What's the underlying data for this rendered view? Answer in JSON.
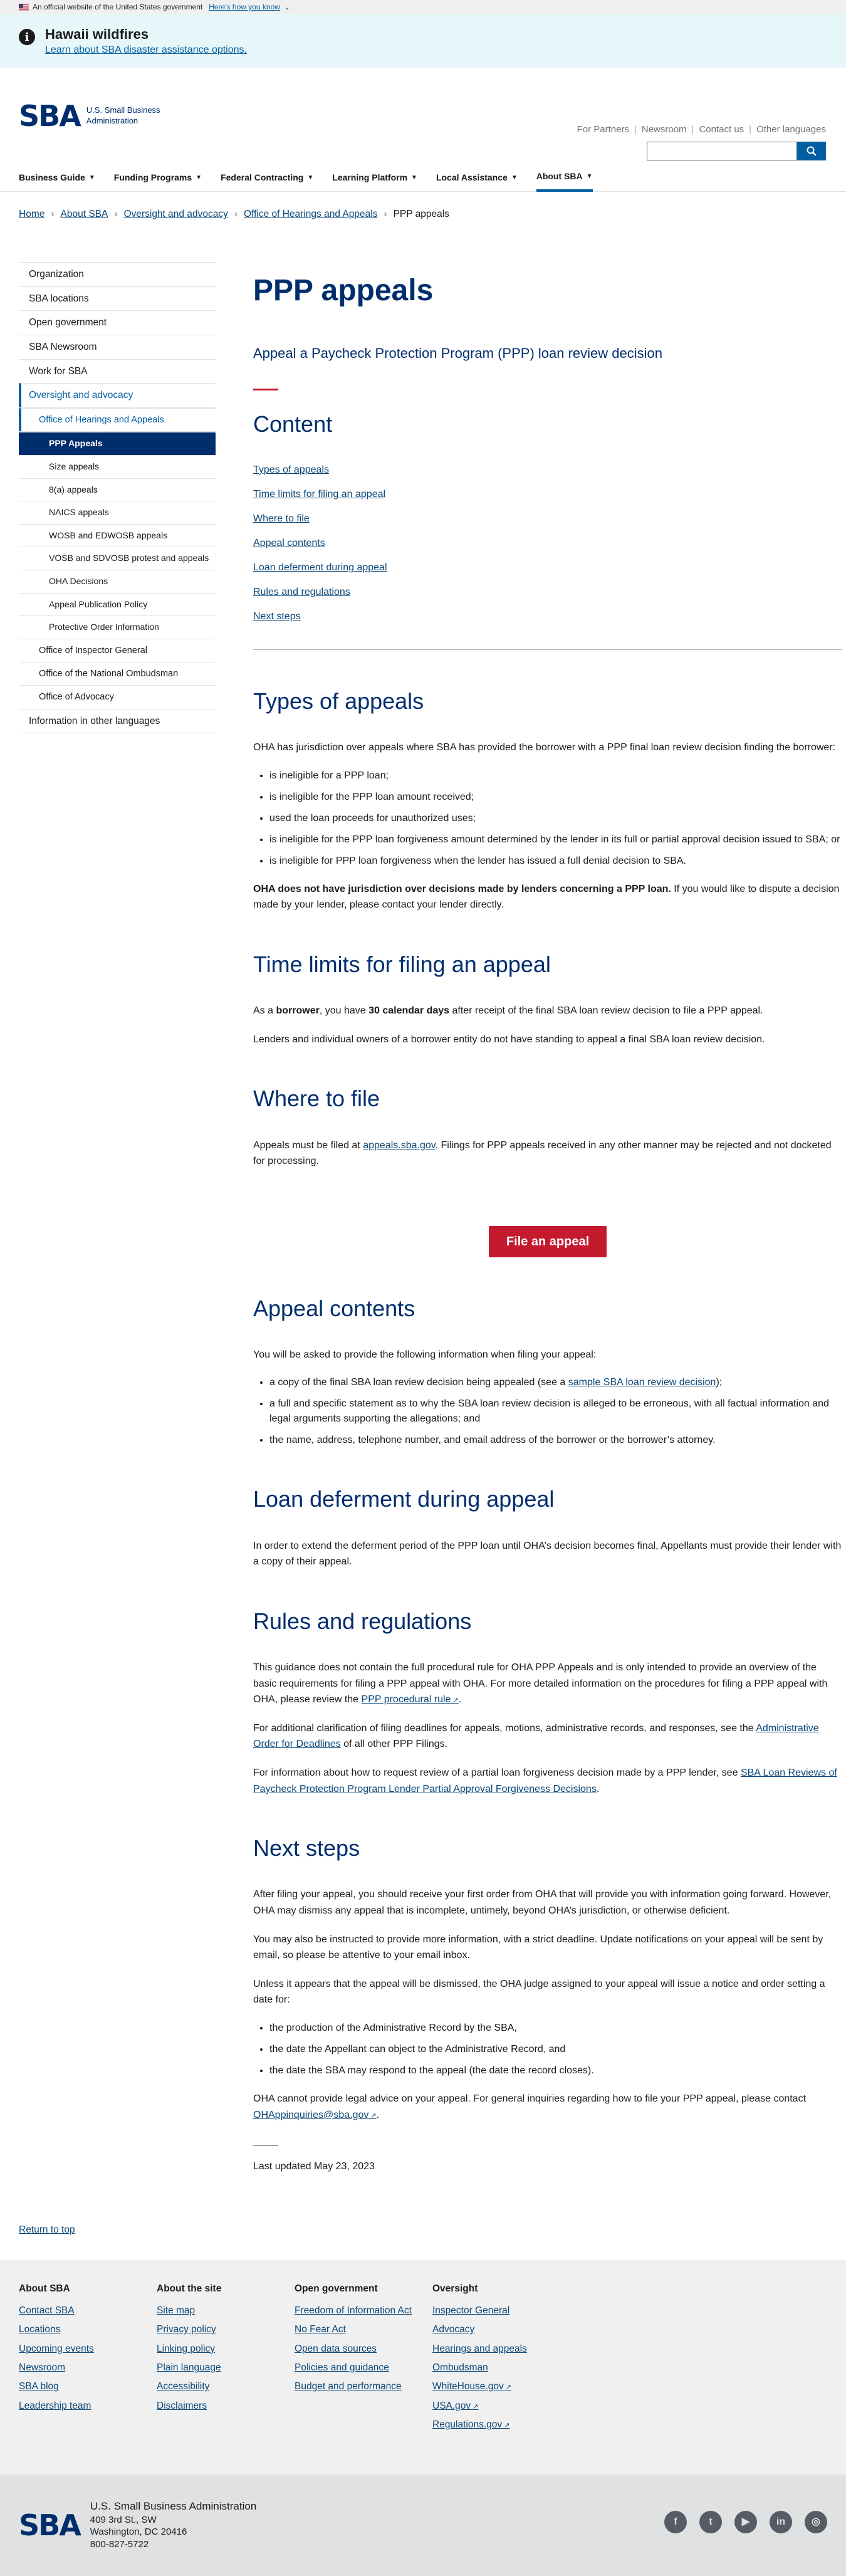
{
  "gov_banner": {
    "text": "An official website of the United States government",
    "link": "Here's how you know",
    "chevron": "⌄"
  },
  "alert": {
    "title": "Hawaii wildfires",
    "link": "Learn about SBA disaster assistance options."
  },
  "header": {
    "logo_mark": "SBA",
    "logo_name_line1": "U.S. Small Business",
    "logo_name_line2": "Administration",
    "top_links": [
      "For Partners",
      "Newsroom",
      "Contact us",
      "Other languages"
    ],
    "search_placeholder": "",
    "search_icon": "search-icon"
  },
  "nav": [
    {
      "label": "Business Guide"
    },
    {
      "label": "Funding Programs"
    },
    {
      "label": "Federal Contracting"
    },
    {
      "label": "Learning Platform"
    },
    {
      "label": "Local Assistance"
    },
    {
      "label": "About SBA"
    }
  ],
  "breadcrumb": {
    "items": [
      "Home",
      "About SBA",
      "Oversight and advocacy",
      "Office of Hearings and Appeals"
    ],
    "current": "PPP appeals"
  },
  "sidenav": {
    "top": [
      "Organization",
      "SBA locations",
      "Open government",
      "SBA Newsroom",
      "Work for SBA"
    ],
    "oversight": "Oversight and advocacy",
    "oha": "Office of Hearings and Appeals",
    "oha_items": [
      "PPP Appeals",
      "Size appeals",
      "8(a) appeals",
      "NAICS appeals",
      "WOSB and EDWOSB appeals",
      "VOSB and SDVOSB protest and appeals",
      "OHA Decisions",
      "Appeal Publication Policy",
      "Protective Order Information"
    ],
    "oversight_items": [
      "Office of Inspector General",
      "Office of the National Ombudsman",
      "Office of Advocacy"
    ],
    "bottom": "Information in other languages"
  },
  "main": {
    "title": "PPP appeals",
    "subtitle": "Appeal a Paycheck Protection Program (PPP) loan review decision",
    "toc_title": "Content",
    "toc": [
      "Types of appeals",
      "Time limits for filing an appeal",
      "Where to file",
      "Appeal contents",
      "Loan deferment during appeal",
      "Rules and regulations",
      "Next steps"
    ],
    "types": {
      "heading": "Types of appeals",
      "intro": "OHA has jurisdiction over appeals where SBA has provided the borrower with a PPP final loan review decision finding the borrower:",
      "items": [
        "is ineligible for a PPP loan;",
        "is ineligible for the PPP loan amount received;",
        "used the loan proceeds for unauthorized uses;",
        "is ineligible for the PPP loan forgiveness amount determined by the lender in its full or partial approval decision issued to SBA; or",
        "is ineligible for PPP loan forgiveness when the lender has issued a full denial decision to SBA."
      ],
      "note_bold": "OHA does not have jurisdiction over decisions made by lenders concerning a PPP loan.",
      "note_rest": " If you would like to dispute a decision made by your lender, please contact your lender directly."
    },
    "time": {
      "heading": "Time limits for filing an appeal",
      "p1_a": "As a ",
      "p1_b": "borrower",
      "p1_c": ", you have ",
      "p1_d": "30 calendar days",
      "p1_e": " after receipt of the final SBA loan review decision to file a PPP appeal.",
      "p2": "Lenders and individual owners of a borrower entity do not have standing to appeal a final SBA loan review decision."
    },
    "where": {
      "heading": "Where to file",
      "p_a": "Appeals must be filed at ",
      "link": "appeals.sba.gov",
      "p_b": ".  Filings for PPP appeals received in any other manner may be rejected and not docketed for processing.",
      "button": "File an appeal"
    },
    "contents": {
      "heading": "Appeal contents",
      "intro": "You will be asked to provide the following information when filing your appeal:",
      "item1_a": "a copy of the final SBA loan review decision being appealed (see a ",
      "item1_link": "sample SBA loan review decision",
      "item1_b": ");",
      "item2": "a full and specific statement as to why the SBA loan review decision is alleged to be erroneous, with all factual information and legal arguments supporting the allegations; and",
      "item3": "the name, address, telephone number, and email address of the borrower or the borrower’s attorney."
    },
    "deferment": {
      "heading": "Loan deferment during appeal",
      "p": "In order to extend the deferment period of the PPP loan until OHA’s decision becomes final, Appellants must provide their lender with a copy of their appeal."
    },
    "rules": {
      "heading": "Rules and regulations",
      "p1_a": "This guidance does not contain the full procedural rule for OHA PPP Appeals and is only intended to provide an overview of the basic requirements for filing a PPP appeal with OHA. For more detailed information on the procedures for filing a PPP appeal with OHA, please review the ",
      "p1_link": "PPP procedural rule",
      "p1_b": ".",
      "p2_a": "For additional clarification of filing deadlines for appeals, motions, administrative records, and responses, see the ",
      "p2_link": "Administrative Order for Deadlines",
      "p2_b": " of all other PPP Filings.",
      "p3_a": "For information about how to request review of a partial loan forgiveness decision made by a PPP lender, see ",
      "p3_link": "SBA Loan Reviews of Paycheck Protection Program Lender Partial Approval Forgiveness Decisions",
      "p3_b": "."
    },
    "next": {
      "heading": "Next steps",
      "p1": "After filing your appeal, you should receive your first order from OHA that will provide you with information going forward. However, OHA may dismiss any appeal that is incomplete, untimely, beyond OHA’s jurisdiction, or otherwise deficient.",
      "p2": "You may also be instructed to provide more information, with a strict deadline.  Update notifications on your appeal will be sent by email, so please be attentive to your email inbox.",
      "p3": "Unless it appears that the appeal will be dismissed, the OHA judge assigned to your appeal will issue a notice and order setting a date for:",
      "items": [
        "the production of the Administrative Record by the SBA,",
        "the date the Appellant can object to the Administrative Record, and",
        "the date the SBA may respond to the appeal (the date the record closes)."
      ],
      "p4_a": "OHA cannot provide legal advice on your appeal. For general inquiries regarding how to file your PPP appeal, please contact ",
      "p4_link": "OHAppinquiries@sba.gov",
      "p4_b": "."
    },
    "updated": "Last updated May 23, 2023"
  },
  "return_top": "Return to top",
  "footer": {
    "cols": [
      {
        "title": "About SBA",
        "links": [
          "Contact SBA",
          "Locations",
          "Upcoming events",
          "Newsroom",
          "SBA blog",
          "Leadership team"
        ]
      },
      {
        "title": "About the site",
        "links": [
          "Site map",
          "Privacy policy",
          "Linking policy",
          "Plain language",
          "Accessibility",
          "Disclaimers"
        ]
      },
      {
        "title": "Open government",
        "links": [
          "Freedom of Information Act",
          "No Fear Act",
          "Open data sources",
          "Policies and guidance",
          "Budget and performance"
        ]
      },
      {
        "title": "Oversight",
        "links": [
          "Inspector General",
          "Advocacy",
          "Hearings and appeals",
          "Ombudsman",
          "WhiteHouse.gov",
          "USA.gov",
          "Regulations.gov"
        ]
      }
    ],
    "org": "U.S. Small Business Administration",
    "addr1": "409 3rd St., SW",
    "addr2": "Washington, DC 20416",
    "phone": "800-827-5722",
    "social": [
      "facebook-icon",
      "twitter-icon",
      "youtube-icon",
      "linkedin-icon",
      "instagram-icon"
    ]
  },
  "colors": {
    "navy": "#002e6d",
    "red": "#c5192d",
    "link": "#0b4778",
    "primary": "#005ea2"
  }
}
